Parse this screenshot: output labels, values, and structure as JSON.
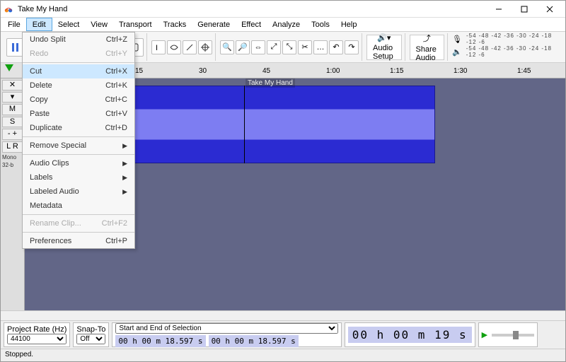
{
  "window": {
    "title": "Take My Hand"
  },
  "menubar": [
    "File",
    "Edit",
    "Select",
    "View",
    "Transport",
    "Tracks",
    "Generate",
    "Effect",
    "Analyze",
    "Tools",
    "Help"
  ],
  "edit_menu": [
    {
      "label": "Undo Split",
      "accel": "Ctrl+Z",
      "enabled": true
    },
    {
      "label": "Redo",
      "accel": "Ctrl+Y",
      "enabled": false
    },
    {
      "sep": true
    },
    {
      "label": "Cut",
      "accel": "Ctrl+X",
      "enabled": true,
      "highlight": true
    },
    {
      "label": "Delete",
      "accel": "Ctrl+K",
      "enabled": true
    },
    {
      "label": "Copy",
      "accel": "Ctrl+C",
      "enabled": true
    },
    {
      "label": "Paste",
      "accel": "Ctrl+V",
      "enabled": true
    },
    {
      "label": "Duplicate",
      "accel": "Ctrl+D",
      "enabled": true
    },
    {
      "sep": true
    },
    {
      "label": "Remove Special",
      "submenu": true,
      "enabled": true
    },
    {
      "sep": true
    },
    {
      "label": "Audio Clips",
      "submenu": true,
      "enabled": true
    },
    {
      "label": "Labels",
      "submenu": true,
      "enabled": true
    },
    {
      "label": "Labeled Audio",
      "submenu": true,
      "enabled": true
    },
    {
      "label": "Metadata",
      "enabled": true
    },
    {
      "sep": true
    },
    {
      "label": "Rename Clip...",
      "accel": "Ctrl+F2",
      "enabled": false
    },
    {
      "sep": true
    },
    {
      "label": "Preferences",
      "accel": "Ctrl+P",
      "enabled": true
    }
  ],
  "toolbar_labels": {
    "audio_setup": "Audio Setup",
    "share_audio": "Share Audio"
  },
  "ruler_ticks": [
    "15",
    "30",
    "45",
    "1:00",
    "1:15",
    "1:30",
    "1:45"
  ],
  "track": {
    "name": "Take My Hand",
    "info1": "Mono",
    "info2": "32-b"
  },
  "bottom": {
    "project_rate_label": "Project Rate (Hz)",
    "project_rate_value": "44100",
    "snap_label": "Snap-To",
    "snap_value": "Off",
    "selection_label": "Start and End of Selection",
    "sel_start": "00 h 00 m 18.597 s",
    "sel_end": "00 h 00 m 18.597 s",
    "big_time": "00 h 00 m 19 s"
  },
  "meter_nums": "-54 -48 -42 -36 -30 -24 -18 -12 -6",
  "status": "Stopped."
}
